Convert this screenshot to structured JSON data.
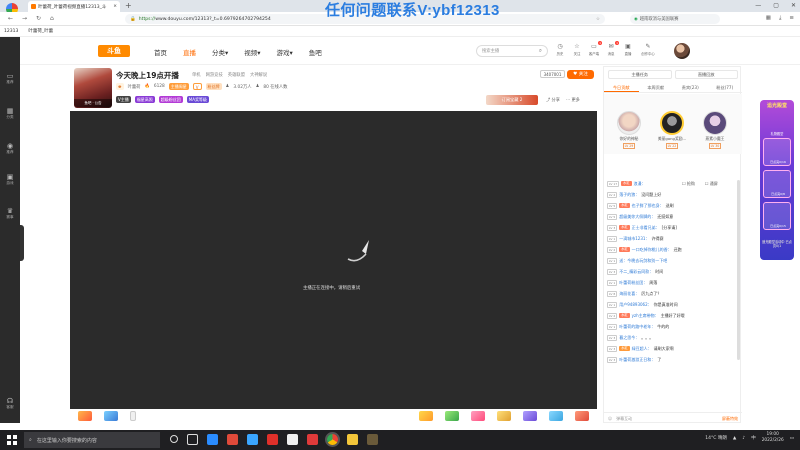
{
  "browser": {
    "tab_title": "叶蕾荷_叶蕾荷视频直播12313_斗",
    "url_scheme": "https://",
    "url_rest": "www.douyu.com/12313?_t=0.6979264702794254",
    "search_placeholder": "越南取消与美国联赛",
    "bookmark": "叶蕾荷_叶蕾",
    "bookmark_id": "12313"
  },
  "watermark": "任何问题联系V:ybf12313",
  "leftbar": {
    "items": [
      {
        "label": "推荐",
        "icon": "monitor-icon"
      },
      {
        "label": "分类",
        "icon": "grid-icon"
      },
      {
        "label": "推荐",
        "icon": "eye-icon"
      },
      {
        "label": "游戏",
        "icon": "gamepad-icon"
      },
      {
        "label": "赛事",
        "icon": "trophy-icon"
      },
      {
        "label": "客服",
        "icon": "headset-icon"
      }
    ]
  },
  "header": {
    "logo": "斗鱼",
    "nav": [
      "首页",
      "直播",
      "分类▾",
      "视频▾",
      "游戏▾",
      "鱼吧"
    ],
    "search_placeholder": "搜索主播",
    "icons": [
      {
        "label": "历史",
        "name": "history-icon",
        "glyph": "◷"
      },
      {
        "label": "关注",
        "name": "follow-icon",
        "glyph": "☆"
      },
      {
        "label": "客户端",
        "name": "client-icon",
        "glyph": "▭",
        "badge": "1"
      },
      {
        "label": "消息",
        "name": "message-icon",
        "glyph": "✉",
        "badge": "1"
      },
      {
        "label": "直播",
        "name": "live-icon",
        "glyph": "▣"
      },
      {
        "label": "创作中心",
        "name": "creator-icon",
        "glyph": "✎"
      }
    ]
  },
  "room": {
    "title": "今天晚上19点开播",
    "category": [
      "单机",
      "网游竞技",
      "英雄联盟",
      "大神解说"
    ],
    "id": "3407001",
    "follow": "关注",
    "anchor_tag": "鱼吧 · 公告",
    "anchor_name": "叶蕾荷",
    "hot": "6128",
    "level_badge": "主播周星",
    "v_badge": "V",
    "fans_badge": "粉丝牌",
    "fans_count": "3.02万人",
    "online": "80 在线人数",
    "badges": [
      "V主播",
      "福星高照",
      "超级粉丝团",
      "MA奖等级"
    ],
    "wallpaper": "订阅宝藏 2",
    "share": "分享",
    "more": "更多"
  },
  "player": {
    "message": "主播正在连接中，请稍后重试"
  },
  "chat": {
    "top_buttons": [
      "主播任务",
      "直播回放"
    ],
    "tabs": [
      "今日贡献",
      "本周贡献",
      "贵宾(23)",
      "粉丝(77)"
    ],
    "rank_users": [
      {
        "name": "你好的神秘",
        "lv": "LV 29"
      },
      {
        "name": "美丽gong奖励...",
        "lv": "LV 22"
      },
      {
        "name": "燕素小魔王",
        "lv": "LV 30"
      }
    ],
    "toggles": [
      "抢购",
      "通屏"
    ],
    "messages": [
      {
        "lv": "LV 17",
        "fan": "水缸",
        "name": "浪漫：",
        "text": ""
      },
      {
        "lv": "LV 2",
        "fan": "",
        "name": "落子的狼：",
        "text": "没问题上好"
      },
      {
        "lv": "LV 5",
        "fan": "水缸",
        "name": "也子鲜了那也身：",
        "text": "送刷"
      },
      {
        "lv": "LV 5",
        "fan": "",
        "name": "超级美你大佩脚的：",
        "text": "还挺如意"
      },
      {
        "lv": "LV 3",
        "fan": "水缸",
        "name": "正士非看兄弟：",
        "text": "[分享请]"
      },
      {
        "lv": "LV 1",
        "fan": "",
        "name": "一滴城市1231：",
        "text": "许得赛"
      },
      {
        "lv": "LV 2",
        "fan": "水缸",
        "name": "一口吃掉你桃儿的香：",
        "text": "还跑"
      },
      {
        "lv": "LV 1",
        "fan": "",
        "name": "送：今晚去玩剑和别一下吧",
        "text": ""
      },
      {
        "lv": "LV 3",
        "fan": "",
        "name": "不二_精彩云同款：",
        "text": "时间"
      },
      {
        "lv": "LV 1",
        "fan": "",
        "name": "叶蕾荷粉丝团：",
        "text": "周落"
      },
      {
        "lv": "LV 8",
        "fan": "",
        "name": "海丽花喜：",
        "text": "厉九点了？"
      },
      {
        "lv": "LV 1",
        "fan": "",
        "name": "用户94893062：",
        "text": "你是真准时间"
      },
      {
        "lv": "LV 2",
        "fan": "水缸",
        "name": "yzh主席带物：",
        "text": "主播好了好哦"
      },
      {
        "lv": "LV 1",
        "fan": "",
        "name": "叶蕾荷的路中老年：",
        "text": "牛的的"
      },
      {
        "lv": "LV 3",
        "fan": "",
        "name": "暮之思今：",
        "text": "。。。"
      },
      {
        "lv": "LV 3",
        "fan": "水缸",
        "name": "绿豆超人：",
        "text": "请刷大家啊"
      },
      {
        "lv": "LV 3",
        "fan": "",
        "name": "叶蕾荷激游正日和：",
        "text": "了"
      }
    ],
    "input_placeholder": "弹幕互动",
    "send": "屏蔽特效"
  },
  "promo": {
    "title": "追光殿堂",
    "sub": "礼物殿堂",
    "cards": [
      "已点亮0/16",
      "已点亮0/8",
      "已点亮0/15"
    ],
    "footer": "追光殿堂活动中 已点亮0/1"
  },
  "taskbar": {
    "search": "在这里输入你要搜索的内容",
    "weather": "14°C 晴朗",
    "time": "19:00",
    "date": "2022/2/26",
    "lang": "中"
  },
  "colors": {
    "accent": "#ff6a00",
    "player_bg": "#2b2b2b",
    "watermark": "#2b7de0",
    "taskbar": "#1f1f22"
  }
}
